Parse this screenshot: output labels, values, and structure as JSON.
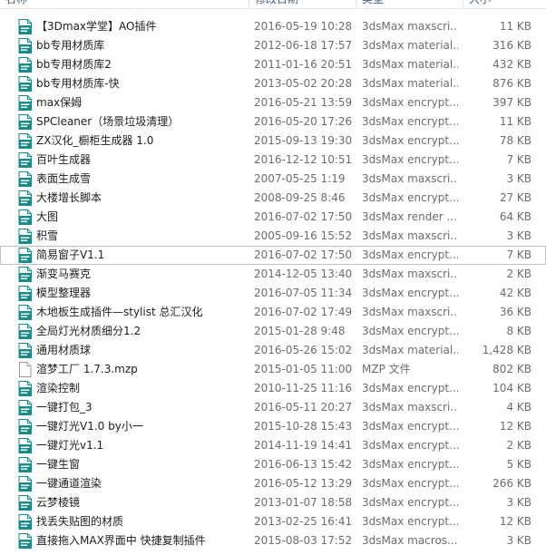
{
  "header": {
    "name_label": "名称",
    "date_label": "修改日期",
    "type_label": "类型",
    "size_label": "大小"
  },
  "icon_colors": {
    "script": "#1a8a8a",
    "file": "#9a9a9a"
  },
  "files": [
    {
      "name": "【3Dmax学堂】AO插件",
      "date": "2016-05-19 10:28",
      "type": "3dsMax maxscri...",
      "size": "11 KB",
      "icon": "script-icon"
    },
    {
      "name": "bb专用材质库",
      "date": "2012-06-18 17:57",
      "type": "3dsMax material...",
      "size": "316 KB",
      "icon": "script-icon"
    },
    {
      "name": "bb专用材质库2",
      "date": "2011-01-16 20:51",
      "type": "3dsMax material...",
      "size": "432 KB",
      "icon": "script-icon"
    },
    {
      "name": "bb专用材质库-快",
      "date": "2013-05-02 20:28",
      "type": "3dsMax material...",
      "size": "876 KB",
      "icon": "script-icon"
    },
    {
      "name": "max保姆",
      "date": "2016-05-21 13:59",
      "type": "3dsMax encrypt...",
      "size": "397 KB",
      "icon": "script-icon"
    },
    {
      "name": "SPCleaner（场景垃圾清理）",
      "date": "2016-05-20 17:26",
      "type": "3dsMax encrypt...",
      "size": "11 KB",
      "icon": "script-icon"
    },
    {
      "name": "ZX汉化_橱柜生成器 1.0",
      "date": "2015-09-13 19:30",
      "type": "3dsMax encrypt...",
      "size": "78 KB",
      "icon": "script-icon"
    },
    {
      "name": "百叶生成器",
      "date": "2016-12-12 10:51",
      "type": "3dsMax encrypt...",
      "size": "7 KB",
      "icon": "script-icon"
    },
    {
      "name": "表面生成雪",
      "date": "2007-05-25 1:19",
      "type": "3dsMax maxscri...",
      "size": "3 KB",
      "icon": "script-icon"
    },
    {
      "name": "大楼增长脚本",
      "date": "2008-09-25 8:46",
      "type": "3dsMax encrypt...",
      "size": "27 KB",
      "icon": "script-icon"
    },
    {
      "name": "大图",
      "date": "2016-07-02 17:50",
      "type": "3dsMax render ...",
      "size": "64 KB",
      "icon": "script-icon"
    },
    {
      "name": "积雪",
      "date": "2005-09-16 15:52",
      "type": "3dsMax maxscri...",
      "size": "3 KB",
      "icon": "script-icon"
    },
    {
      "name": "简易窗子V1.1",
      "date": "2016-07-02 17:50",
      "type": "3dsMax encrypt...",
      "size": "7 KB",
      "icon": "script-icon",
      "selected": true
    },
    {
      "name": "渐变马赛克",
      "date": "2014-12-05 13:40",
      "type": "3dsMax maxscri...",
      "size": "2 KB",
      "icon": "script-icon"
    },
    {
      "name": "模型整理器",
      "date": "2016-07-05 11:34",
      "type": "3dsMax encrypt...",
      "size": "42 KB",
      "icon": "script-icon"
    },
    {
      "name": "木地板生成插件—stylist 总汇汉化",
      "date": "2016-07-02 17:49",
      "type": "3dsMax maxscri...",
      "size": "36 KB",
      "icon": "script-icon"
    },
    {
      "name": "全局灯光材质细分1.2",
      "date": "2015-01-28 9:48",
      "type": "3dsMax encrypt...",
      "size": "8 KB",
      "icon": "script-icon"
    },
    {
      "name": "通用材质球",
      "date": "2016-05-26 15:02",
      "type": "3dsMax material...",
      "size": "1,428 KB",
      "icon": "script-icon"
    },
    {
      "name": "渲梦工厂 1.7.3.mzp",
      "date": "2015-01-05 11:00",
      "type": "MZP 文件",
      "size": "802 KB",
      "icon": "file-icon"
    },
    {
      "name": "渲染控制",
      "date": "2010-11-25 11:16",
      "type": "3dsMax encrypt...",
      "size": "104 KB",
      "icon": "script-icon"
    },
    {
      "name": "一键打包_3",
      "date": "2016-05-11 20:27",
      "type": "3dsMax maxscri...",
      "size": "4 KB",
      "icon": "script-icon"
    },
    {
      "name": "一键灯光V1.0 by小一",
      "date": "2015-10-28 15:43",
      "type": "3dsMax encrypt...",
      "size": "12 KB",
      "icon": "script-icon"
    },
    {
      "name": "一键灯光v1.1",
      "date": "2014-11-19 14:41",
      "type": "3dsMax encrypt...",
      "size": "2 KB",
      "icon": "script-icon"
    },
    {
      "name": "一键生窗",
      "date": "2016-06-13 15:42",
      "type": "3dsMax encrypt...",
      "size": "5 KB",
      "icon": "script-icon"
    },
    {
      "name": "一键通道渲染",
      "date": "2016-05-12 13:29",
      "type": "3dsMax encrypt...",
      "size": "266 KB",
      "icon": "script-icon"
    },
    {
      "name": "云梦棱镜",
      "date": "2013-01-07 18:58",
      "type": "3dsMax encrypt...",
      "size": "3 KB",
      "icon": "script-icon"
    },
    {
      "name": "找丢失贴图的材质",
      "date": "2013-02-25 16:41",
      "type": "3dsMax encrypt...",
      "size": "12 KB",
      "icon": "script-icon"
    },
    {
      "name": "直接拖入MAX界面中 快捷复制插件",
      "date": "2015-08-03 17:52",
      "type": "3dsMax macros...",
      "size": "3 KB",
      "icon": "script-icon"
    }
  ]
}
